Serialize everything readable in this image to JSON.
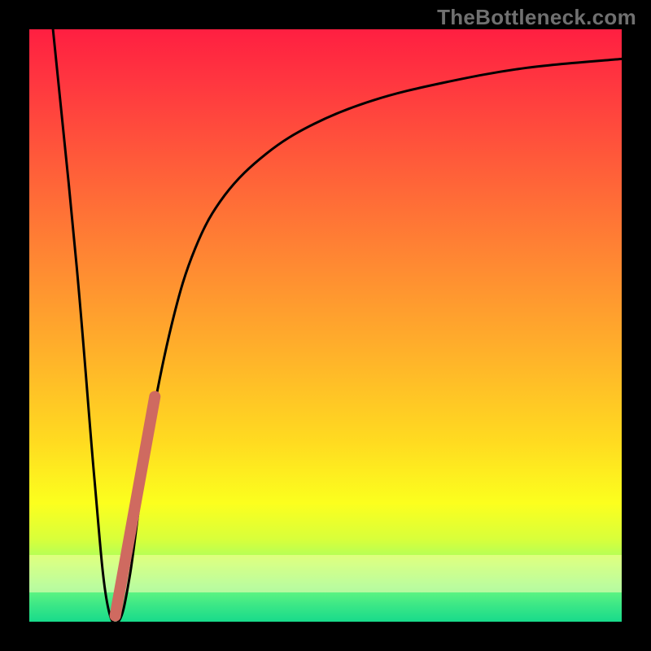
{
  "watermark": "TheBottleneck.com",
  "chart_data": {
    "type": "line",
    "title": "",
    "xlabel": "",
    "ylabel": "",
    "xlim": [
      0,
      100
    ],
    "ylim": [
      0,
      100
    ],
    "series": [
      {
        "name": "main-curve",
        "x": [
          4,
          8,
          11,
          13,
          15,
          17,
          20,
          24,
          28,
          33,
          40,
          48,
          58,
          70,
          84,
          100
        ],
        "y": [
          100,
          60,
          24,
          4,
          0,
          8,
          30,
          50,
          63,
          72,
          79,
          84,
          88,
          91,
          93.5,
          95
        ]
      },
      {
        "name": "accent-segment",
        "x": [
          14.5,
          21.2
        ],
        "y": [
          1,
          38
        ]
      }
    ],
    "gradient_bg": {
      "top": "#ff1f41",
      "bottom": "#18db8b"
    },
    "accent_color": "#cf6a60"
  }
}
